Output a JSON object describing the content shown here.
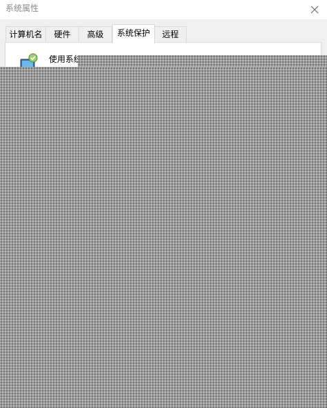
{
  "window": {
    "title": "系统属性",
    "close_icon": "close-icon"
  },
  "tabs": [
    {
      "label": "计算机名",
      "active": false
    },
    {
      "label": "硬件",
      "active": false
    },
    {
      "label": "高级",
      "active": false
    },
    {
      "label": "系统保护",
      "active": true
    },
    {
      "label": "远程",
      "active": false
    }
  ],
  "panel": {
    "icon": "system-protection-icon",
    "intro_text": "使用系统"
  },
  "colors": {
    "titlebar": "#ffffff",
    "window_bg": "#f0f0f0",
    "panel_bg": "#ffffff",
    "overlay_pattern": "#9c9c9c"
  }
}
